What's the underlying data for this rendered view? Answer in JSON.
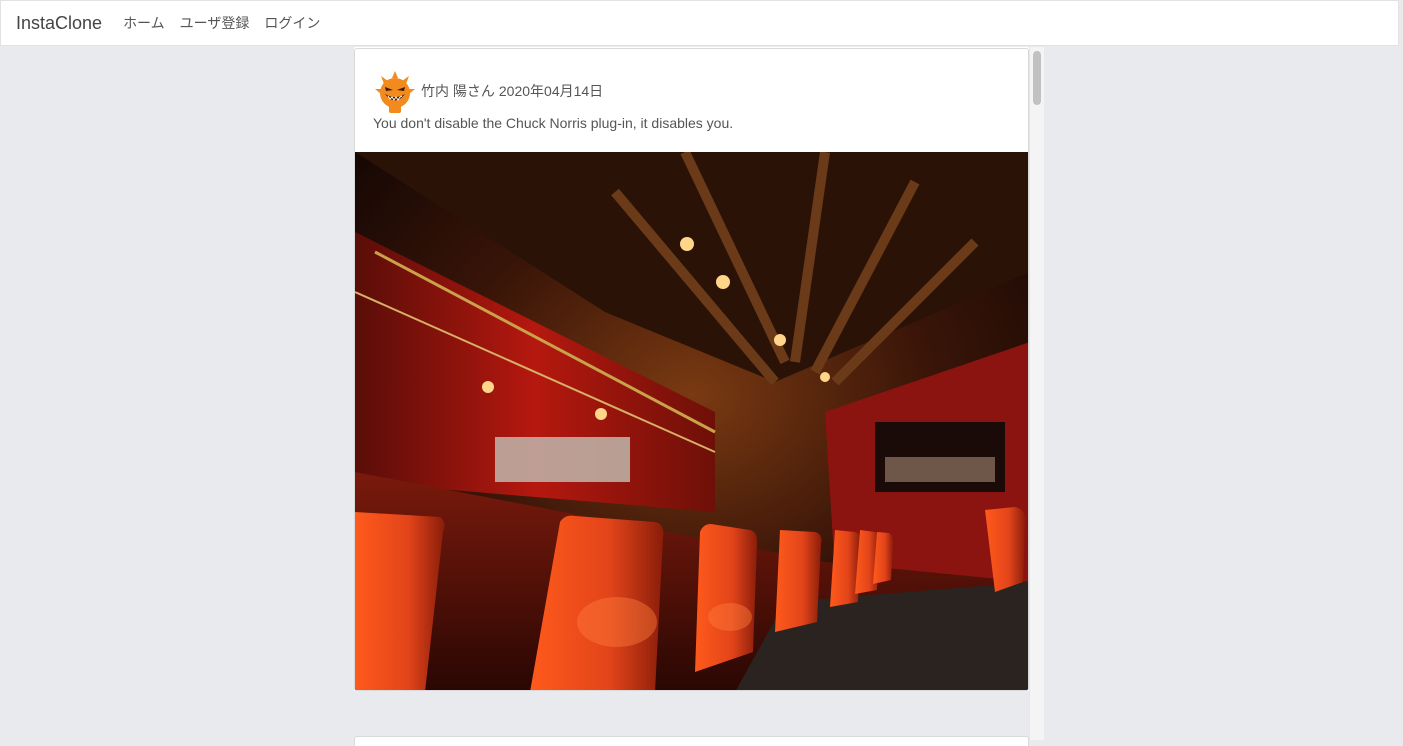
{
  "navbar": {
    "brand": "InstaClone",
    "links": [
      "ホーム",
      "ユーザ登録",
      "ログイン"
    ]
  },
  "post": {
    "author": "竹内 陽さん",
    "date": "2020年04月14日",
    "text": "You don't disable the Chuck Norris plug-in, it disables you.",
    "avatar_icon": "devil-face-icon",
    "image_alt": "Restaurant bar interior with red chairs"
  },
  "colors": {
    "background": "#e9eaee",
    "avatar": "#f28a1e",
    "chair": "#e2541b"
  }
}
